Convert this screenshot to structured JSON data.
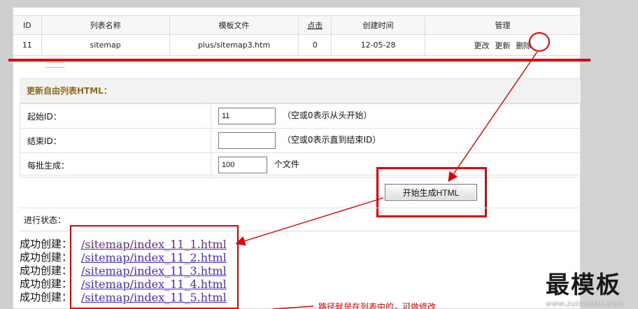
{
  "top_table": {
    "headers": [
      "ID",
      "列表名称",
      "模板文件",
      "点击",
      "创建时间",
      "管理"
    ],
    "row": {
      "id": "11",
      "name": "sitemap",
      "template": "plus/sitemap3.htm",
      "clicks": "0",
      "created": "12-05-28",
      "actions": [
        "更改",
        "更新",
        "删除"
      ]
    }
  },
  "section": {
    "title": "更新自由列表HTML："
  },
  "form": {
    "start_id_label": "起始ID：",
    "start_id_value": "11",
    "start_id_note": "（空或0表示从头开始）",
    "end_id_label": "结束ID：",
    "end_id_value": "",
    "end_id_note": "（空或0表示直到结束ID）",
    "batch_label": "每批生成：",
    "batch_value": "100",
    "batch_unit": "个文件"
  },
  "action": {
    "button_label": "开始生成HTML"
  },
  "status": {
    "label": "进行状态："
  },
  "log": {
    "items": [
      {
        "prefix": "成功创建：",
        "path": "/sitemap/index_11_1.html"
      },
      {
        "prefix": "成功创建：",
        "path": "/sitemap/index_11_2.html"
      },
      {
        "prefix": "成功创建：",
        "path": "/sitemap/index_11_3.html"
      },
      {
        "prefix": "成功创建：",
        "path": "/sitemap/index_11_4.html"
      },
      {
        "prefix": "成功创建：",
        "path": "/sitemap/index_11_5.html"
      }
    ]
  },
  "annotation": {
    "text": "路径就是在列表中的，可做修改"
  },
  "watermark": {
    "brand": "最模板",
    "url": "www.zuimoban.com"
  },
  "colors": {
    "annotation_red": "#e00000",
    "section_title": "#8c6b1c",
    "link": "#4b2cc8"
  }
}
